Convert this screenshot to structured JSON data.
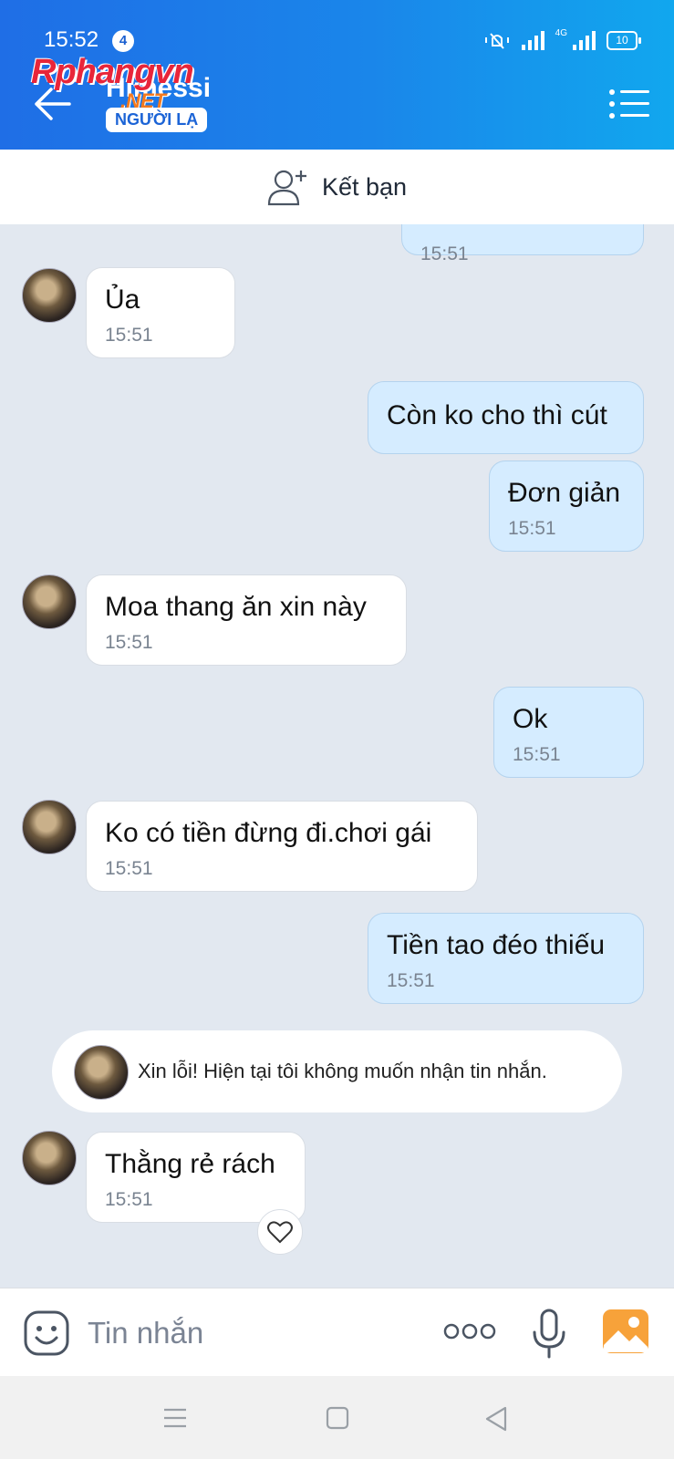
{
  "status_bar": {
    "time": "15:52",
    "notification_count": "4",
    "network": "4G",
    "battery": "10"
  },
  "header": {
    "watermark": "Rphangvn",
    "watermark_sub": ".NET",
    "contact_name": "Himessi",
    "badge": "NGƯỜI LẠ"
  },
  "friend_bar": {
    "label": "Kết bạn"
  },
  "messages": [
    {
      "side": "out",
      "text": "",
      "time": "15:51"
    },
    {
      "side": "in",
      "text": "Ủa",
      "time": "15:51"
    },
    {
      "side": "out",
      "text": "Còn ko cho thì cút",
      "time": ""
    },
    {
      "side": "out",
      "text": "Đơn giản",
      "time": "15:51"
    },
    {
      "side": "in",
      "text": "Moa thang ăn xin này",
      "time": "15:51"
    },
    {
      "side": "out",
      "text": "Ok",
      "time": "15:51"
    },
    {
      "side": "in",
      "text": "Ko có tiền đừng đi.chơi gái",
      "time": "15:51"
    },
    {
      "side": "out",
      "text": "Tiền tao đéo thiếu",
      "time": "15:51"
    },
    {
      "side": "in",
      "text": "Thằng rẻ rách",
      "time": "15:51"
    }
  ],
  "system_message": "Xin lỗi! Hiện tại tôi không muốn nhận tin nhắn.",
  "input": {
    "placeholder": "Tin nhắn"
  },
  "icons": [
    "back-arrow-icon",
    "menu-list-icon",
    "add-friend-icon",
    "emoji-icon",
    "more-icon",
    "microphone-icon",
    "image-icon",
    "heart-icon",
    "nav-menu-icon",
    "nav-home-icon",
    "nav-back-icon"
  ]
}
